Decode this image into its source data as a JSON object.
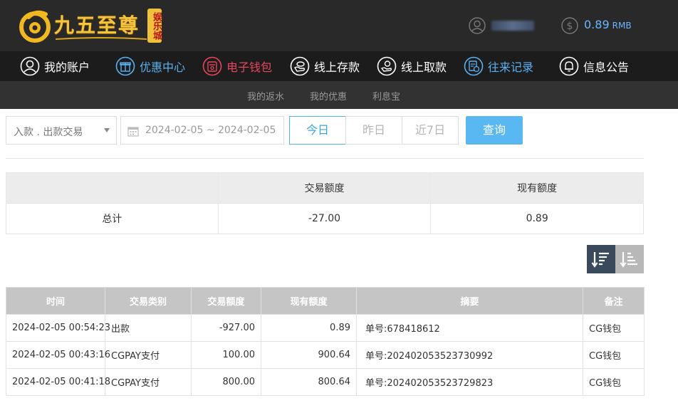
{
  "header": {
    "logo_text": "九五至尊",
    "logo_badge": "娱乐城",
    "balance": "0.89",
    "balance_unit": "RMB"
  },
  "nav": [
    {
      "label": "我的账户",
      "icon": "user-icon",
      "color": "#ffffff"
    },
    {
      "label": "优惠中心",
      "icon": "gift-icon",
      "color": "#5ab0f0"
    },
    {
      "label": "电子钱包",
      "icon": "wallet-icon",
      "color": "#e8455d"
    },
    {
      "label": "线上存款",
      "icon": "deposit-icon",
      "color": "#ffffff"
    },
    {
      "label": "线上取款",
      "icon": "withdraw-icon",
      "color": "#ffffff"
    },
    {
      "label": "往来记录",
      "icon": "records-icon",
      "color": "#5ab0f0"
    },
    {
      "label": "信息公告",
      "icon": "bell-icon",
      "color": "#ffffff"
    }
  ],
  "subnav": [
    "我的返水",
    "我的优惠",
    "利息宝"
  ],
  "filter": {
    "type_select": "入款 . 出款交易",
    "date_range": "2024-02-05 ~ 2024-02-05",
    "today": "今日",
    "yesterday": "昨日",
    "last7": "近7日",
    "query": "查询"
  },
  "summary": {
    "headers": [
      "",
      "交易额度",
      "现有额度"
    ],
    "row": [
      "总计",
      "-27.00",
      "0.89"
    ]
  },
  "records": {
    "headers": [
      "时间",
      "交易类别",
      "交易额度",
      "现有额度",
      "摘要",
      "备注"
    ],
    "rows": [
      [
        "2024-02-05 00:54:23",
        "出款",
        "-927.00",
        "0.89",
        "单号:678418612",
        "CG钱包"
      ],
      [
        "2024-02-05 00:43:16",
        "CGPAY支付",
        "100.00",
        "900.64",
        "单号:202402053523730992",
        "CG钱包"
      ],
      [
        "2024-02-05 00:41:18",
        "CGPAY支付",
        "800.00",
        "800.64",
        "单号:202402053523729823",
        "CG钱包"
      ]
    ]
  }
}
